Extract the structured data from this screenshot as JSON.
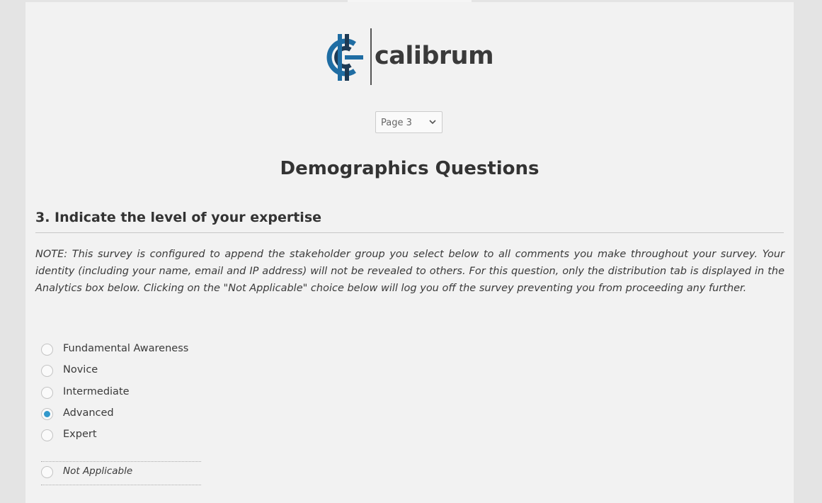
{
  "brand": {
    "name": "calibrum",
    "logo_icon": "calibrum-logo-icon",
    "colors": {
      "icon_blue": "#1f6da3",
      "icon_dark": "#1d3a54",
      "text": "#3a3a3a"
    }
  },
  "pagination": {
    "selected": "Page 3",
    "icon": "chevron-down-icon"
  },
  "section": {
    "title": "Demographics Questions"
  },
  "question": {
    "title": "3. Indicate the level of your expertise",
    "note": "NOTE: This survey is configured to append the stakeholder group you select below to all comments you make throughout your survey. Your identity (including your name, email and IP address) will not be revealed to others. For this question, only the distribution tab is displayed in the Analytics box below. Clicking on the \"Not Applicable\" choice below will log you off the survey preventing you from proceeding any further.",
    "options": [
      {
        "label": "Fundamental Awareness",
        "selected": false
      },
      {
        "label": "Novice",
        "selected": false
      },
      {
        "label": "Intermediate",
        "selected": false
      },
      {
        "label": "Advanced",
        "selected": true
      },
      {
        "label": "Expert",
        "selected": false
      }
    ],
    "not_applicable": {
      "label": "Not Applicable",
      "selected": false
    },
    "accent_color": "#3399cc"
  }
}
